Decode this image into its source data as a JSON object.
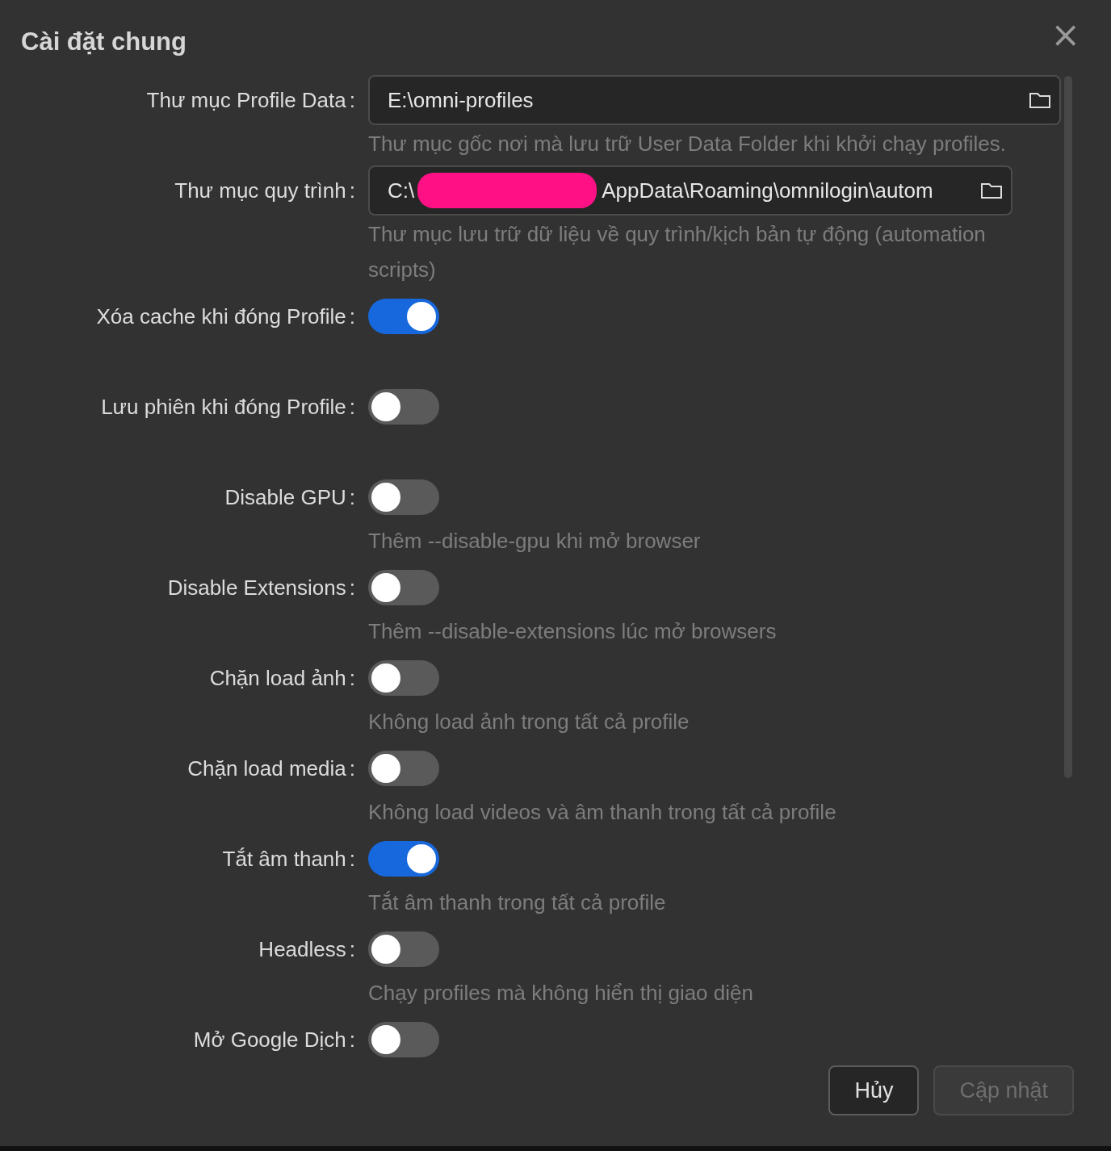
{
  "dialog": {
    "title": "Cài đặt chung",
    "close": "×"
  },
  "settings": [
    {
      "kind": "folder",
      "label": "Thư mục Profile Data",
      "colon": ":",
      "value": "E:\\omni-profiles",
      "help": "Thư mục gốc nơi mà lưu trữ User Data Folder khi khởi chạy profiles."
    },
    {
      "kind": "folder",
      "label": "Thư mục quy trình",
      "colon": ":",
      "value": "C:\\",
      "redacted": true,
      "value_end": "AppData\\Roaming\\omnilogin\\autom",
      "help": "Thư mục lưu trữ dữ liệu về quy trình/kịch bản tự động (automation scripts)"
    },
    {
      "kind": "toggle",
      "label": "Xóa cache khi đóng Profile",
      "colon": ":",
      "on": true
    },
    {
      "kind": "toggle",
      "label": "Lưu phiên khi đóng Profile",
      "colon": ":",
      "on": false
    },
    {
      "kind": "toggle",
      "label": "Disable GPU",
      "colon": ":",
      "on": false,
      "help": "Thêm --disable-gpu khi mở browser"
    },
    {
      "kind": "toggle",
      "label": "Disable Extensions",
      "colon": ":",
      "on": false,
      "help": "Thêm --disable-extensions lúc mở browsers"
    },
    {
      "kind": "toggle",
      "label": "Chặn load ảnh",
      "colon": ":",
      "on": false,
      "help": "Không load ảnh trong tất cả profile"
    },
    {
      "kind": "toggle",
      "label": "Chặn load media",
      "colon": ":",
      "on": false,
      "help": "Không load videos và âm thanh trong tất cả profile"
    },
    {
      "kind": "toggle",
      "label": "Tắt âm thanh",
      "colon": ":",
      "on": true,
      "help": "Tắt âm thanh trong tất cả profile"
    },
    {
      "kind": "toggle",
      "label": "Headless",
      "colon": ":",
      "on": false,
      "help": "Chạy profiles mà không hiển thị giao diện"
    },
    {
      "kind": "toggle",
      "label": "Mở Google Dịch",
      "colon": ":",
      "on": false
    }
  ],
  "buttons": [
    {
      "label": "Hủy",
      "disabled": false
    },
    {
      "label": "Cập nhật",
      "disabled": true
    }
  ]
}
